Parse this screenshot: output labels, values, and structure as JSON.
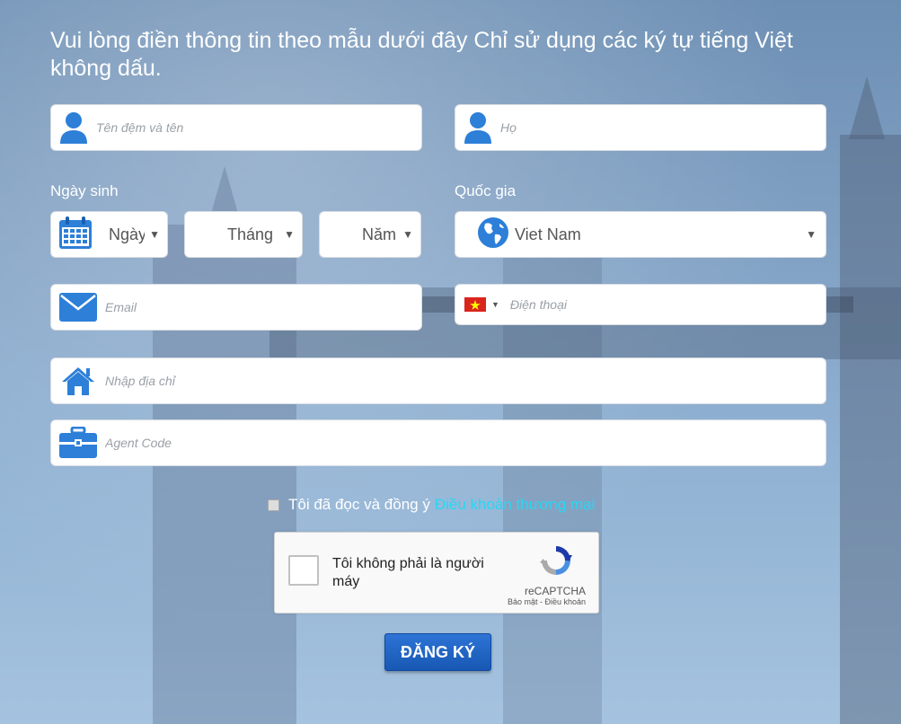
{
  "heading": "Vui lòng điền thông tin theo mẫu dưới đây Chỉ sử dụng các ký tự tiếng Việt không dấu.",
  "fields": {
    "first_name_placeholder": "Tên đệm và tên",
    "last_name_placeholder": "Họ",
    "email_placeholder": "Email",
    "phone_placeholder": "Điện thoại",
    "address_placeholder": "Nhập địa chỉ",
    "agent_code_placeholder": "Agent Code"
  },
  "birthdate": {
    "label": "Ngày sinh",
    "day": "Ngày",
    "month": "Tháng",
    "year": "Năm"
  },
  "country": {
    "label": "Quốc gia",
    "selected": "Viet Nam"
  },
  "terms": {
    "text": "Tôi đã đọc và đồng ý",
    "link": "Điều khoản thương mại"
  },
  "captcha": {
    "text": "Tôi không phải là người máy",
    "brand": "reCAPTCHA",
    "links": "Bảo mật - Điều khoản"
  },
  "submit_label": "ĐĂNG KÝ",
  "colors": {
    "accent": "#2d7fd8",
    "link": "#27d7f5",
    "button": "#1f63c4"
  },
  "icons": {
    "first_name": "user-icon",
    "last_name": "user-icon",
    "birthdate": "calendar-icon",
    "country": "globe-icon",
    "email": "envelope-icon",
    "phone": "vietnam-flag-icon",
    "address": "home-icon",
    "agent_code": "briefcase-icon"
  }
}
